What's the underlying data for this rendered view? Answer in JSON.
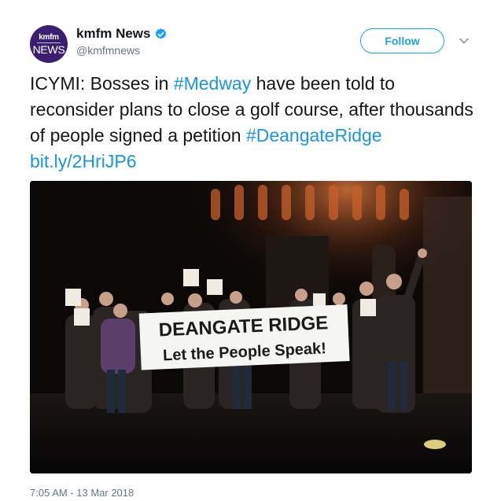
{
  "account": {
    "avatar_top": "kmfm",
    "avatar_bottom": "NEWS",
    "display_name": "kmfm News",
    "handle": "@kmfmnews"
  },
  "follow_label": "Follow",
  "tweet": {
    "text_part1": "ICYMI: Bosses in ",
    "hashtag1": "#Medway",
    "text_part2": " have been told to reconsider plans to close a golf course, after thousands of people signed a petition ",
    "hashtag2": "#DeangateRidge",
    "link": "bit.ly/2HriJP6"
  },
  "photo": {
    "banner_line1": "DEANGATE RIDGE",
    "banner_line2": "Let the People Speak!"
  },
  "timestamp": "7:05 AM - 13 Mar 2018",
  "colors": {
    "accent": "#1da1f2",
    "link": "#1b95e0",
    "avatar_bg": "#3a1f6e"
  },
  "icons": [
    "verified-badge-icon",
    "chevron-down-icon"
  ]
}
